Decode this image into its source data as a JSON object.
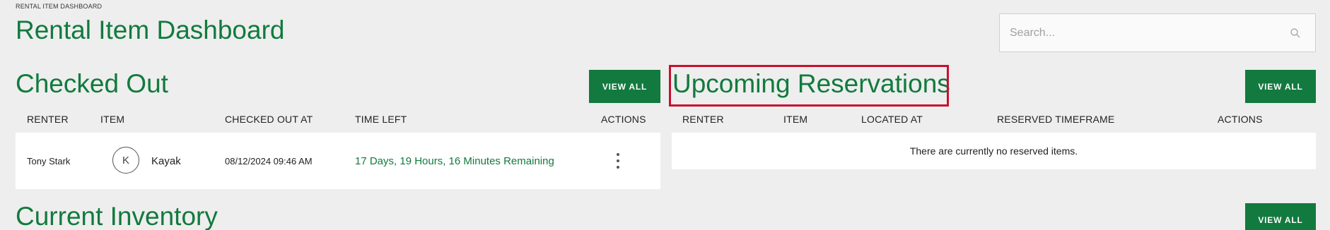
{
  "breadcrumb": "RENTAL ITEM DASHBOARD",
  "page_title": "Rental Item Dashboard",
  "search": {
    "placeholder": "Search..."
  },
  "checked_out": {
    "title": "Checked Out",
    "view_all": "VIEW ALL",
    "columns": [
      "RENTER",
      "ITEM",
      "CHECKED OUT AT",
      "TIME LEFT",
      "ACTIONS"
    ],
    "rows": [
      {
        "renter": "Tony Stark",
        "item_initial": "K",
        "item": "Kayak",
        "checked_out_at": "08/12/2024 09:46 AM",
        "time_left": "17 Days, 19 Hours, 16 Minutes Remaining"
      }
    ]
  },
  "upcoming": {
    "title": "Upcoming Reservations",
    "view_all": "VIEW ALL",
    "columns": [
      "RENTER",
      "ITEM",
      "LOCATED AT",
      "RESERVED TIMEFRAME",
      "ACTIONS"
    ],
    "empty_message": "There are currently no reserved items."
  },
  "inventory": {
    "title": "Current Inventory",
    "view_all": "VIEW ALL"
  },
  "colors": {
    "brand_green": "#127a3e",
    "highlight_red": "#c8102e",
    "background": "#eeeeee"
  },
  "icons": {
    "search": "search-icon",
    "actions": "kebab-menu-icon"
  }
}
